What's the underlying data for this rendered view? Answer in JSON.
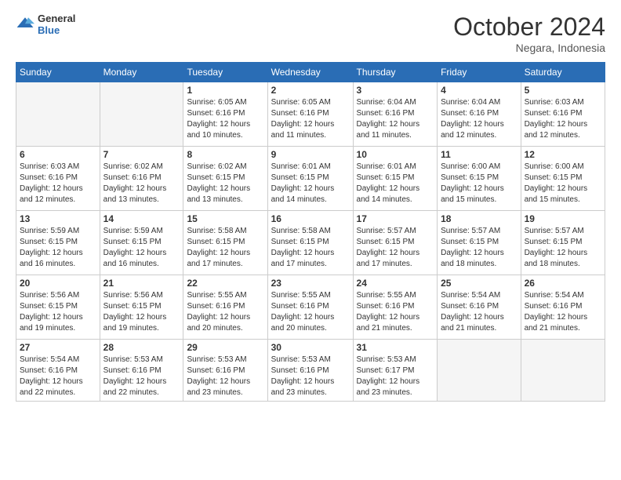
{
  "logo": {
    "general": "General",
    "blue": "Blue"
  },
  "header": {
    "month_year": "October 2024",
    "location": "Negara, Indonesia"
  },
  "weekdays": [
    "Sunday",
    "Monday",
    "Tuesday",
    "Wednesday",
    "Thursday",
    "Friday",
    "Saturday"
  ],
  "weeks": [
    [
      {
        "day": "",
        "empty": true
      },
      {
        "day": "",
        "empty": true
      },
      {
        "day": "1",
        "sunrise": "6:05 AM",
        "sunset": "6:16 PM",
        "daylight": "12 hours and 10 minutes."
      },
      {
        "day": "2",
        "sunrise": "6:05 AM",
        "sunset": "6:16 PM",
        "daylight": "12 hours and 11 minutes."
      },
      {
        "day": "3",
        "sunrise": "6:04 AM",
        "sunset": "6:16 PM",
        "daylight": "12 hours and 11 minutes."
      },
      {
        "day": "4",
        "sunrise": "6:04 AM",
        "sunset": "6:16 PM",
        "daylight": "12 hours and 12 minutes."
      },
      {
        "day": "5",
        "sunrise": "6:03 AM",
        "sunset": "6:16 PM",
        "daylight": "12 hours and 12 minutes."
      }
    ],
    [
      {
        "day": "6",
        "sunrise": "6:03 AM",
        "sunset": "6:16 PM",
        "daylight": "12 hours and 12 minutes."
      },
      {
        "day": "7",
        "sunrise": "6:02 AM",
        "sunset": "6:16 PM",
        "daylight": "12 hours and 13 minutes."
      },
      {
        "day": "8",
        "sunrise": "6:02 AM",
        "sunset": "6:15 PM",
        "daylight": "12 hours and 13 minutes."
      },
      {
        "day": "9",
        "sunrise": "6:01 AM",
        "sunset": "6:15 PM",
        "daylight": "12 hours and 14 minutes."
      },
      {
        "day": "10",
        "sunrise": "6:01 AM",
        "sunset": "6:15 PM",
        "daylight": "12 hours and 14 minutes."
      },
      {
        "day": "11",
        "sunrise": "6:00 AM",
        "sunset": "6:15 PM",
        "daylight": "12 hours and 15 minutes."
      },
      {
        "day": "12",
        "sunrise": "6:00 AM",
        "sunset": "6:15 PM",
        "daylight": "12 hours and 15 minutes."
      }
    ],
    [
      {
        "day": "13",
        "sunrise": "5:59 AM",
        "sunset": "6:15 PM",
        "daylight": "12 hours and 16 minutes."
      },
      {
        "day": "14",
        "sunrise": "5:59 AM",
        "sunset": "6:15 PM",
        "daylight": "12 hours and 16 minutes."
      },
      {
        "day": "15",
        "sunrise": "5:58 AM",
        "sunset": "6:15 PM",
        "daylight": "12 hours and 17 minutes."
      },
      {
        "day": "16",
        "sunrise": "5:58 AM",
        "sunset": "6:15 PM",
        "daylight": "12 hours and 17 minutes."
      },
      {
        "day": "17",
        "sunrise": "5:57 AM",
        "sunset": "6:15 PM",
        "daylight": "12 hours and 17 minutes."
      },
      {
        "day": "18",
        "sunrise": "5:57 AM",
        "sunset": "6:15 PM",
        "daylight": "12 hours and 18 minutes."
      },
      {
        "day": "19",
        "sunrise": "5:57 AM",
        "sunset": "6:15 PM",
        "daylight": "12 hours and 18 minutes."
      }
    ],
    [
      {
        "day": "20",
        "sunrise": "5:56 AM",
        "sunset": "6:15 PM",
        "daylight": "12 hours and 19 minutes."
      },
      {
        "day": "21",
        "sunrise": "5:56 AM",
        "sunset": "6:15 PM",
        "daylight": "12 hours and 19 minutes."
      },
      {
        "day": "22",
        "sunrise": "5:55 AM",
        "sunset": "6:16 PM",
        "daylight": "12 hours and 20 minutes."
      },
      {
        "day": "23",
        "sunrise": "5:55 AM",
        "sunset": "6:16 PM",
        "daylight": "12 hours and 20 minutes."
      },
      {
        "day": "24",
        "sunrise": "5:55 AM",
        "sunset": "6:16 PM",
        "daylight": "12 hours and 21 minutes."
      },
      {
        "day": "25",
        "sunrise": "5:54 AM",
        "sunset": "6:16 PM",
        "daylight": "12 hours and 21 minutes."
      },
      {
        "day": "26",
        "sunrise": "5:54 AM",
        "sunset": "6:16 PM",
        "daylight": "12 hours and 21 minutes."
      }
    ],
    [
      {
        "day": "27",
        "sunrise": "5:54 AM",
        "sunset": "6:16 PM",
        "daylight": "12 hours and 22 minutes."
      },
      {
        "day": "28",
        "sunrise": "5:53 AM",
        "sunset": "6:16 PM",
        "daylight": "12 hours and 22 minutes."
      },
      {
        "day": "29",
        "sunrise": "5:53 AM",
        "sunset": "6:16 PM",
        "daylight": "12 hours and 23 minutes."
      },
      {
        "day": "30",
        "sunrise": "5:53 AM",
        "sunset": "6:16 PM",
        "daylight": "12 hours and 23 minutes."
      },
      {
        "day": "31",
        "sunrise": "5:53 AM",
        "sunset": "6:17 PM",
        "daylight": "12 hours and 23 minutes."
      },
      {
        "day": "",
        "empty": true
      },
      {
        "day": "",
        "empty": true
      }
    ]
  ],
  "labels": {
    "sunrise": "Sunrise:",
    "sunset": "Sunset:",
    "daylight": "Daylight:"
  }
}
